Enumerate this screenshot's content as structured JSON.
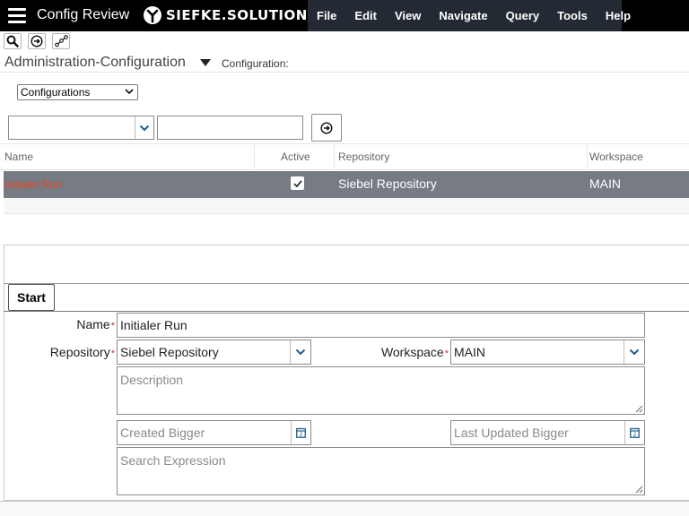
{
  "app": {
    "title": "Config Review",
    "brand": "SIEFKE.SOLUTIONS"
  },
  "menu": [
    "File",
    "Edit",
    "View",
    "Navigate",
    "Query",
    "Tools",
    "Help"
  ],
  "toolbar": {
    "icons": [
      "search-icon",
      "go-icon",
      "connections-icon"
    ]
  },
  "view": {
    "title": "Administration-Configuration",
    "subtitle": "Configuration:"
  },
  "visibility": {
    "selected": "Configurations"
  },
  "query": {
    "field_value": "",
    "value": ""
  },
  "list": {
    "columns": [
      "Name",
      "Active",
      "Repository",
      "Workspace"
    ],
    "rows": [
      {
        "name": "Initialer Run",
        "active": true,
        "repository": "Siebel Repository",
        "workspace": "MAIN"
      }
    ]
  },
  "form": {
    "tab_label": "Start",
    "name_label": "Name",
    "name_value": "Initialer Run",
    "repository_label": "Repository",
    "repository_value": "Siebel Repository",
    "workspace_label": "Workspace",
    "workspace_value": "MAIN",
    "description_placeholder": "Description",
    "created_placeholder": "Created Bigger",
    "updated_placeholder": "Last Updated Bigger",
    "search_placeholder": "Search Expression",
    "required_marker": "*"
  },
  "colors": {
    "topbar": "#000000",
    "menubar": "#232a34",
    "selected_row": "#767b84",
    "name_link": "#e8451d",
    "required": "#c0392b"
  }
}
